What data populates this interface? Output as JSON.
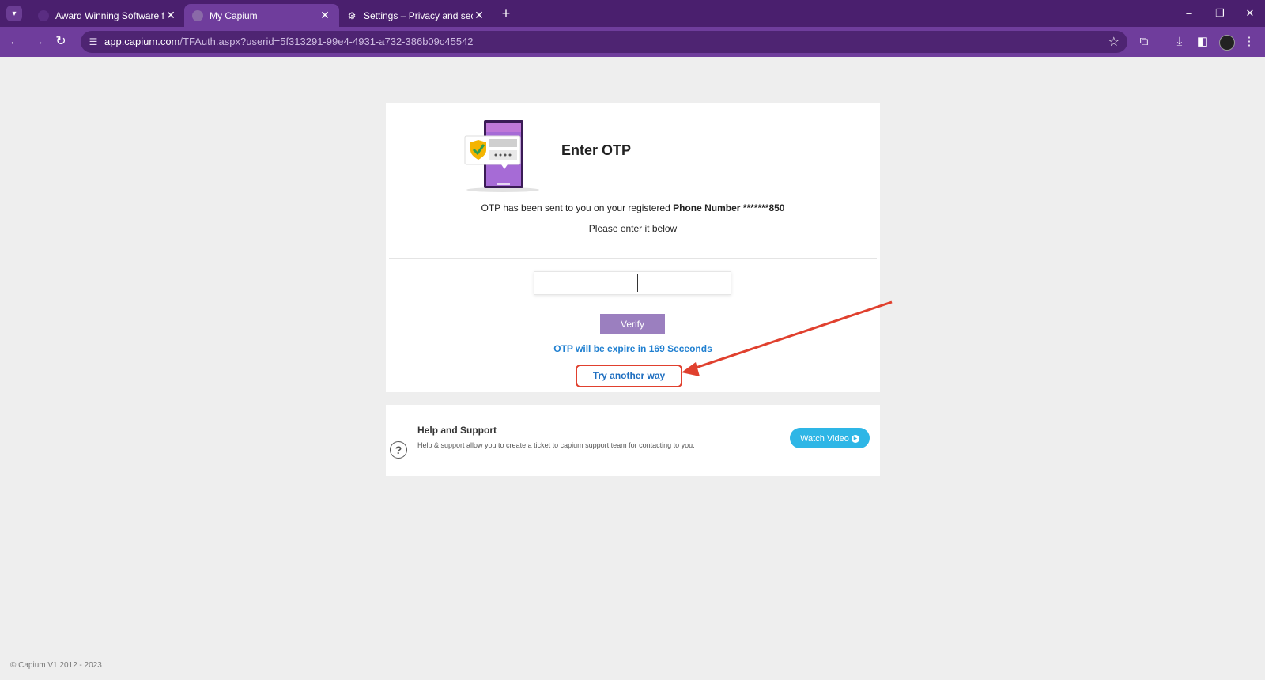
{
  "browser": {
    "tabs": [
      {
        "title": "Award Winning Software for Ac",
        "active": false
      },
      {
        "title": "My Capium",
        "active": true
      },
      {
        "title": "Settings – Privacy and security",
        "active": false
      }
    ],
    "close_glyph": "✕",
    "newtab_glyph": "+",
    "url_domain": "app.capium.com",
    "url_path": "/TFAuth.aspx?userid=5f313291-99e4-4931-a732-386b09c45542",
    "icons": {
      "back": "arrow-left-icon",
      "forward": "arrow-right-icon",
      "reload": "reload-icon",
      "site_info": "tune-icon",
      "bookmark": "star-icon",
      "extensions": "puzzle-icon",
      "downloads": "download-icon",
      "sidepanel": "sidepanel-icon",
      "menu": "kebab-menu-icon"
    }
  },
  "otp": {
    "title": "Enter OTP",
    "sent_prefix": "OTP has been sent to you on your registered ",
    "sent_bold": "Phone Number *******850",
    "enter_below": "Please enter it below",
    "input_value": "",
    "verify_label": "Verify",
    "expire_text": "OTP will be expire in 169  Seceonds",
    "try_another_label": "Try another way"
  },
  "help": {
    "title": "Help and Support",
    "description": "Help & support allow you to create a ticket to capium support team for contacting to you.",
    "watch_label": "Watch Video"
  },
  "footer": "© Capium V1 2012 - 2023",
  "colors": {
    "tabstrip": "#4a1f6e",
    "toolbar": "#6f3d9c",
    "verify": "#9b7fbf",
    "link": "#1f7fd0",
    "annotation": "#e0402e",
    "watch": "#2eb6e6"
  }
}
